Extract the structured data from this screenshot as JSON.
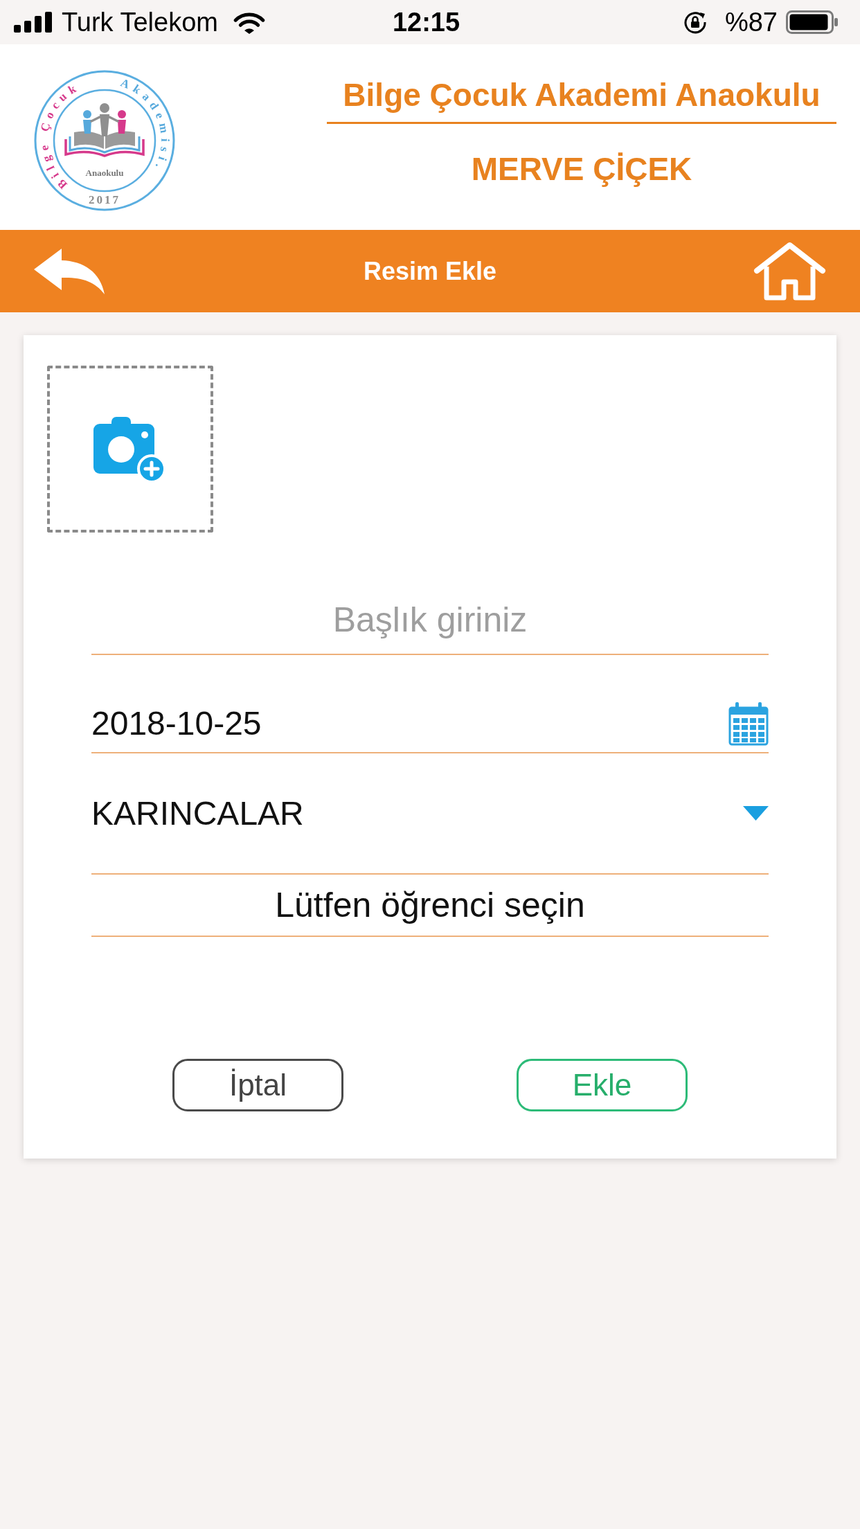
{
  "status_bar": {
    "carrier": "Turk Telekom",
    "time": "12:15",
    "battery": "%87"
  },
  "header": {
    "logo": {
      "ring_texts": [
        {
          "text": "Bilge Çocuk",
          "color": "#d6398b"
        },
        {
          "text": "Akademisi.",
          "color": "#56a9dc"
        }
      ],
      "center_text": "Anaokulu",
      "year": "2017"
    },
    "school_name": "Bilge Çocuk Akademi Anaokulu",
    "user_name": "MERVE ÇİÇEK"
  },
  "nav_bar": {
    "title": "Resim Ekle"
  },
  "form": {
    "fields": [
      {
        "kind": "text",
        "placeholder": "Başlık giriniz"
      },
      {
        "kind": "date",
        "value": "2018-10-25"
      },
      {
        "kind": "select",
        "value": "KARINCALAR"
      },
      {
        "kind": "picker",
        "value": "Lütfen öğrenci seçin"
      }
    ],
    "buttons": [
      {
        "kind": "cancel",
        "label": "İptal"
      },
      {
        "kind": "submit",
        "label": "Ekle"
      }
    ]
  }
}
